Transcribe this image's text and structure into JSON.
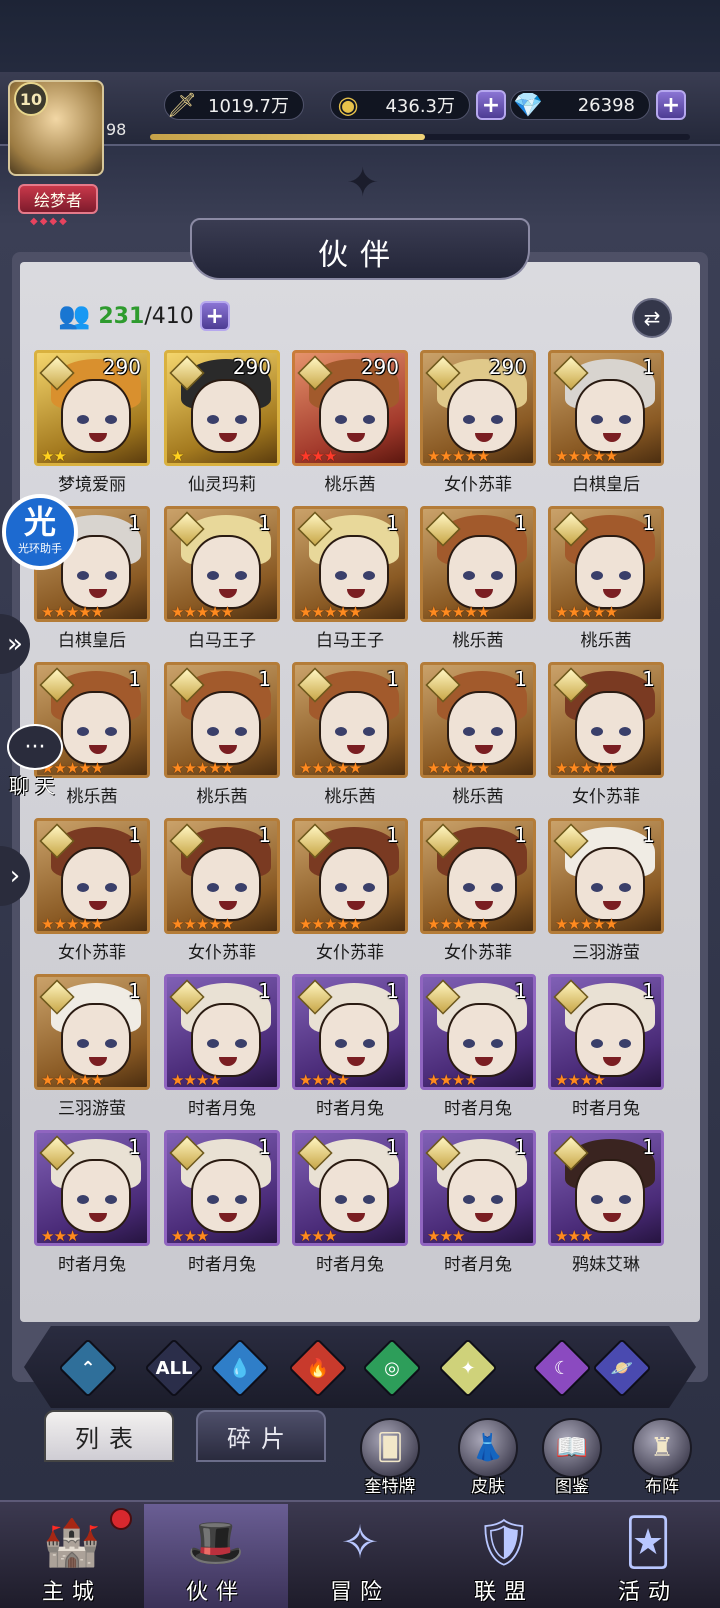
{
  "player": {
    "level": "10",
    "sub_value": "98",
    "title": "绘梦者",
    "title_dots": "◆◆◆◆",
    "xp_fraction": 0.51
  },
  "resources": {
    "power": "1019.7万",
    "gold": "436.3万",
    "diamonds": "26398",
    "plus": "+"
  },
  "panel": {
    "title": "伙伴",
    "count_owned": "231",
    "count_max": "/410",
    "plus": "+",
    "sort_icon": "⇄"
  },
  "characters": [
    {
      "name": "梦境爱丽",
      "level": "290",
      "stars": "★★",
      "star_color": "gold",
      "frame": "gold",
      "hair": "#d9902e"
    },
    {
      "name": "仙灵玛莉",
      "level": "290",
      "stars": "★",
      "star_color": "gold",
      "frame": "gold",
      "hair": "#2a2a2a"
    },
    {
      "name": "桃乐茜",
      "level": "290",
      "stars": "★★★",
      "star_color": "red",
      "frame": "red",
      "hair": "#a25a2c"
    },
    {
      "name": "女仆苏菲",
      "level": "290",
      "stars": "★★★★★",
      "star_color": "orange",
      "frame": "bronze",
      "hair": "#e0c98a"
    },
    {
      "name": "白棋皇后",
      "level": "1",
      "stars": "★★★★★",
      "star_color": "orange",
      "frame": "bronze",
      "hair": "#d8d4cf"
    },
    {
      "name": "白棋皇后",
      "level": "1",
      "stars": "★★★★★",
      "star_color": "orange",
      "frame": "bronze",
      "hair": "#d8d4cf"
    },
    {
      "name": "白马王子",
      "level": "1",
      "stars": "★★★★★",
      "star_color": "orange",
      "frame": "bronze",
      "hair": "#e8d89a"
    },
    {
      "name": "白马王子",
      "level": "1",
      "stars": "★★★★★",
      "star_color": "orange",
      "frame": "bronze",
      "hair": "#e8d89a"
    },
    {
      "name": "桃乐茜",
      "level": "1",
      "stars": "★★★★★",
      "star_color": "orange",
      "frame": "bronze",
      "hair": "#a25a2c"
    },
    {
      "name": "桃乐茜",
      "level": "1",
      "stars": "★★★★★",
      "star_color": "orange",
      "frame": "bronze",
      "hair": "#a25a2c"
    },
    {
      "name": "桃乐茜",
      "level": "1",
      "stars": "★★★★★",
      "star_color": "orange",
      "frame": "bronze",
      "hair": "#a25a2c"
    },
    {
      "name": "桃乐茜",
      "level": "1",
      "stars": "★★★★★",
      "star_color": "orange",
      "frame": "bronze",
      "hair": "#a25a2c"
    },
    {
      "name": "桃乐茜",
      "level": "1",
      "stars": "★★★★★",
      "star_color": "orange",
      "frame": "bronze",
      "hair": "#a25a2c"
    },
    {
      "name": "桃乐茜",
      "level": "1",
      "stars": "★★★★★",
      "star_color": "orange",
      "frame": "bronze",
      "hair": "#a25a2c"
    },
    {
      "name": "女仆苏菲",
      "level": "1",
      "stars": "★★★★★",
      "star_color": "orange",
      "frame": "bronze",
      "hair": "#7a3a22"
    },
    {
      "name": "女仆苏菲",
      "level": "1",
      "stars": "★★★★★",
      "star_color": "orange",
      "frame": "bronze",
      "hair": "#7a3a22"
    },
    {
      "name": "女仆苏菲",
      "level": "1",
      "stars": "★★★★★",
      "star_color": "orange",
      "frame": "bronze",
      "hair": "#7a3a22"
    },
    {
      "name": "女仆苏菲",
      "level": "1",
      "stars": "★★★★★",
      "star_color": "orange",
      "frame": "bronze",
      "hair": "#7a3a22"
    },
    {
      "name": "女仆苏菲",
      "level": "1",
      "stars": "★★★★★",
      "star_color": "orange",
      "frame": "bronze",
      "hair": "#7a3a22"
    },
    {
      "name": "三羽游萤",
      "level": "1",
      "stars": "★★★★★",
      "star_color": "orange",
      "frame": "bronze",
      "hair": "#f0ece4"
    },
    {
      "name": "三羽游萤",
      "level": "1",
      "stars": "★★★★★",
      "star_color": "orange",
      "frame": "bronze",
      "hair": "#f0ece4"
    },
    {
      "name": "时者月兔",
      "level": "1",
      "stars": "★★★★",
      "star_color": "orange",
      "frame": "purple",
      "hair": "#e9e1d4"
    },
    {
      "name": "时者月兔",
      "level": "1",
      "stars": "★★★★",
      "star_color": "orange",
      "frame": "purple",
      "hair": "#e9e1d4"
    },
    {
      "name": "时者月兔",
      "level": "1",
      "stars": "★★★★",
      "star_color": "orange",
      "frame": "purple",
      "hair": "#e9e1d4"
    },
    {
      "name": "时者月兔",
      "level": "1",
      "stars": "★★★★",
      "star_color": "orange",
      "frame": "purple",
      "hair": "#e9e1d4"
    },
    {
      "name": "时者月兔",
      "level": "1",
      "stars": "★★★",
      "star_color": "orange",
      "frame": "purple",
      "hair": "#e9e1d4"
    },
    {
      "name": "时者月兔",
      "level": "1",
      "stars": "★★★",
      "star_color": "orange",
      "frame": "purple",
      "hair": "#e9e1d4"
    },
    {
      "name": "时者月兔",
      "level": "1",
      "stars": "★★★",
      "star_color": "orange",
      "frame": "purple",
      "hair": "#e9e1d4"
    },
    {
      "name": "时者月兔",
      "level": "1",
      "stars": "★★★",
      "star_color": "orange",
      "frame": "purple",
      "hair": "#e9e1d4"
    },
    {
      "name": "鸦妹艾琳",
      "level": "1",
      "stars": "★★★",
      "star_color": "orange",
      "frame": "purple",
      "hair": "#3a2420"
    }
  ],
  "element_filters": [
    {
      "name": "filter-ancient",
      "glyph": "⌃",
      "color": "#2f6f9a"
    },
    {
      "name": "filter-all",
      "glyph": "ALL",
      "color": "#2b2e4a"
    },
    {
      "name": "filter-water",
      "glyph": "💧",
      "color": "#2f7ec8"
    },
    {
      "name": "filter-fire",
      "glyph": "🔥",
      "color": "#c83a2c"
    },
    {
      "name": "filter-wind",
      "glyph": "◎",
      "color": "#2d9e5a"
    },
    {
      "name": "filter-light",
      "glyph": "✦",
      "color": "#cfd27a"
    },
    {
      "name": "filter-dark",
      "glyph": "☾",
      "color": "#8b4ac0"
    },
    {
      "name": "filter-cosmic",
      "glyph": "🪐",
      "color": "#4a4ab0"
    }
  ],
  "tabs": {
    "list": "列表",
    "fragments": "碎片"
  },
  "shortcuts": [
    {
      "label": "奎特牌",
      "icon": "🂠"
    },
    {
      "label": "皮肤",
      "icon": "👗"
    },
    {
      "label": "图鉴",
      "icon": "📖"
    },
    {
      "label": "布阵",
      "icon": "♜"
    }
  ],
  "nav": [
    {
      "label": "主城",
      "icon": "🏰"
    },
    {
      "label": "伙伴",
      "icon": "🎩"
    },
    {
      "label": "冒险",
      "icon": "✧"
    },
    {
      "label": "联盟",
      "icon": "🛡"
    },
    {
      "label": "活动",
      "icon": "🃏"
    }
  ],
  "floaters": {
    "halo_big": "光",
    "halo_small": "光环助手",
    "chat_icon": "···",
    "chat_label": "聊天",
    "arrow": "»",
    "arrow2": "›"
  }
}
